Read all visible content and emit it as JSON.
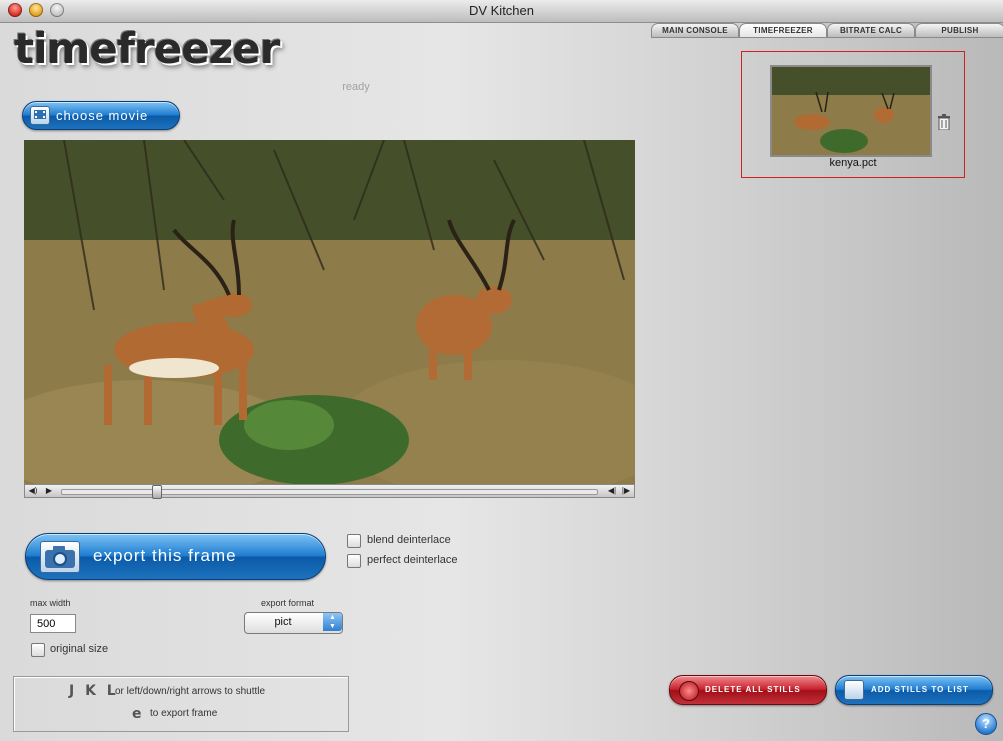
{
  "window": {
    "title": "DV Kitchen"
  },
  "tabs": [
    {
      "label": "MAIN CONSOLE",
      "active": false
    },
    {
      "label": "TIMEFREEZER",
      "active": true
    },
    {
      "label": "BITRATE CALC",
      "active": false
    },
    {
      "label": "PUBLISH",
      "active": false
    }
  ],
  "app": {
    "logo": "timefreezer",
    "status": "ready"
  },
  "buttons": {
    "choose_movie": "choose movie",
    "export_frame": "export this frame",
    "delete_stills": "DELETE ALL STILLS",
    "add_stills": "ADD STILLS TO LIST",
    "help": "?"
  },
  "options": {
    "blend_deinterlace": "blend deinterlace",
    "perfect_deinterlace": "perfect deinterlace",
    "original_size": "original size"
  },
  "max_width": {
    "label": "max width",
    "value": "500"
  },
  "export_format": {
    "label": "export format",
    "value": "pict"
  },
  "help": {
    "keys": "J K L",
    "shuttle_text": "or left/down/right arrows to shuttle",
    "export_key": "e",
    "export_text": "to export frame"
  },
  "stills": [
    {
      "name": "kenya.pct"
    }
  ],
  "colors": {
    "accent_blue": "#1f7dd0",
    "delete_red": "#c8202b",
    "selection_red": "#d21f1f"
  }
}
